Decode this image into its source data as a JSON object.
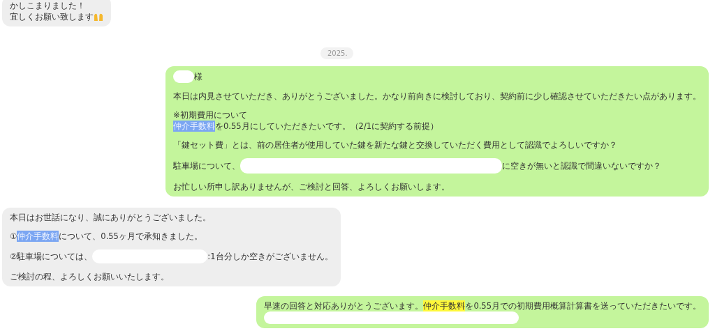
{
  "messages": [
    {
      "kind": "in",
      "paragraphs": [
        [
          [
            {
              "kind": "text",
              "text": "かしこまりました！"
            }
          ],
          [
            {
              "kind": "text",
              "text": "宜しくお願い致します"
            },
            {
              "kind": "emoji"
            }
          ]
        ]
      ]
    },
    {
      "kind": "date",
      "text": "2025."
    },
    {
      "kind": "out",
      "paragraphs": [
        [
          [
            {
              "kind": "redacted"
            },
            {
              "kind": "text",
              "text": "様"
            }
          ]
        ],
        [
          [
            {
              "kind": "text",
              "text": "本日は内見させていただき、ありがとうございました。かなり前向きに検討しており、契約前に少し確認させていただきたい点があります。"
            }
          ]
        ],
        [
          [
            {
              "kind": "text",
              "text": "※初期費用について"
            }
          ],
          [
            {
              "kind": "selection",
              "text": "仲介手数料",
              "color": "#7ba6f2"
            },
            {
              "kind": "text",
              "text": "を0.55月にしていただきたいです。（2/1に契約する前提）"
            }
          ]
        ],
        [
          [
            {
              "kind": "text",
              "text": "「鍵セット費」とは、前の居住者が使用していた鍵を新たな鍵と交換していただく費用として認識でよろしいですか？"
            }
          ]
        ],
        [
          [
            {
              "kind": "text",
              "text": "駐車場について、"
            },
            {
              "kind": "redacted"
            },
            {
              "kind": "text",
              "text": "に空きが無いと認識で間違いないですか？"
            }
          ]
        ],
        [
          [
            {
              "kind": "text",
              "text": "お忙しい所申し訳ありませんが、ご検討と回答、よろしくお願いします。"
            }
          ]
        ]
      ]
    },
    {
      "kind": "in",
      "paragraphs": [
        [
          [
            {
              "kind": "text",
              "text": "本日はお世話になり、誠にありがとうございました。"
            }
          ]
        ],
        [
          [
            {
              "kind": "text",
              "text": "①"
            },
            {
              "kind": "selection",
              "text": "仲介手数料",
              "color": "#7ba6f2"
            },
            {
              "kind": "text",
              "text": "について、0.55ヶ月で承知きました。"
            }
          ]
        ],
        [
          [
            {
              "kind": "text",
              "text": "②駐車場については、"
            },
            {
              "kind": "redacted"
            },
            {
              "kind": "text",
              "text": ":1台分しか空きがございません。"
            }
          ]
        ],
        [
          [
            {
              "kind": "text",
              "text": "ご検討の程、よろしくお願いいたします。"
            }
          ]
        ]
      ]
    },
    {
      "kind": "out",
      "paragraphs": [
        [
          [
            {
              "kind": "text",
              "text": "早速の回答と対応ありがとうございます。"
            },
            {
              "kind": "highlight",
              "text": "仲介手数料",
              "color": "#fff83a"
            },
            {
              "kind": "text",
              "text": "を0.55月での初期費用概算計算書を送っていただきたいです。"
            }
          ],
          [
            {
              "kind": "redacted"
            }
          ]
        ]
      ]
    }
  ]
}
